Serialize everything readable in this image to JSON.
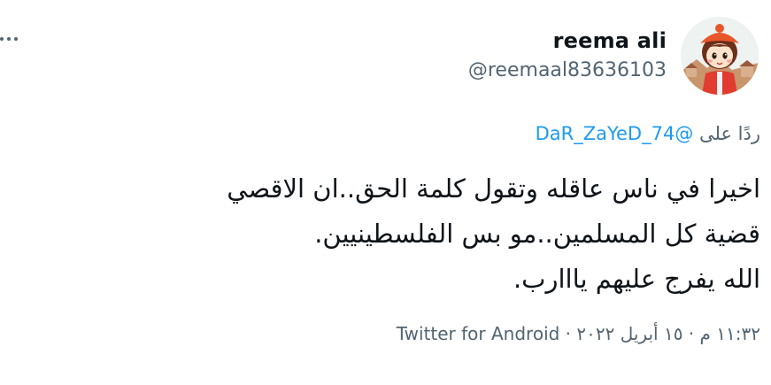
{
  "user": {
    "display_name": "reema ali",
    "handle": "@reemaal83636103"
  },
  "reply": {
    "prefix": "ردًا على",
    "target": "@DaR_ZaYeD_74"
  },
  "tweet": {
    "lines": [
      "اخيرا في ناس عاقله وتقول كلمة الحق..ان الاقصي",
      "قضية كل المسلمين..مو بس الفلسطينيين.",
      "الله يفرج عليهم يااارب."
    ]
  },
  "meta": {
    "time": "١١:٣٢ م",
    "sep1": " · ",
    "date": "١٥ أبريل ٢٠٢٢",
    "sep2": " · ",
    "source": "Twitter for Android"
  },
  "icons": {
    "more": "more-horizontal-icon",
    "avatar": "avatar-cartoon-girl"
  },
  "colors": {
    "text": "#0f1419",
    "secondary": "#536471",
    "link": "#1d9bf0"
  }
}
